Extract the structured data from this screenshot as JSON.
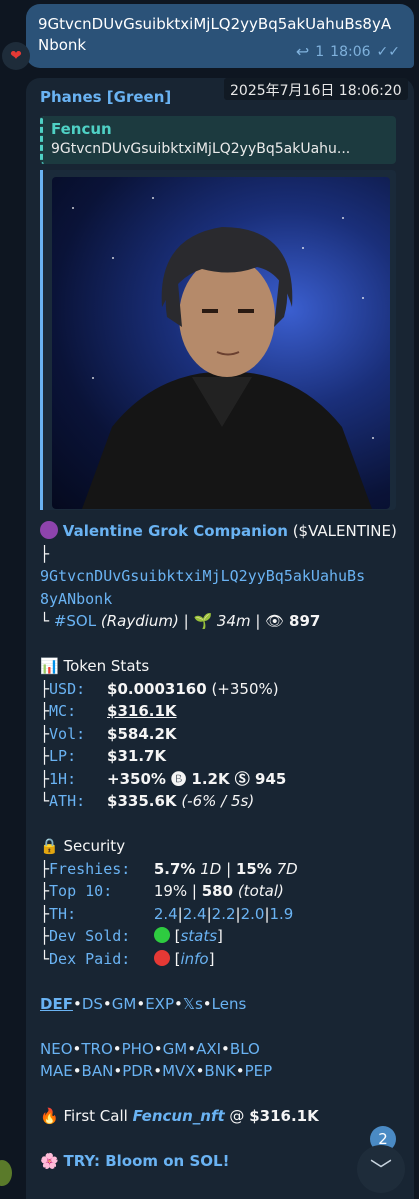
{
  "outgoing": {
    "text": "9GtvcnDUvGsuibktxiMjLQ2yyBq5akUahuBs8yANbonk",
    "reply_count": "1",
    "time": "18:06",
    "reaction": "❤"
  },
  "incoming": {
    "sender": "Phanes [Green]",
    "timestamp_tooltip": "2025年7月16日 18:06:20",
    "quote": {
      "title": "Fencun",
      "text": "9GtvcnDUvGsuibktxiMjLQ2yyBq5akUahu..."
    },
    "token": {
      "name": "Valentine Grok Companion",
      "ticker": "($VALENTINE)",
      "branch": "├",
      "address_1": "9GtvcnDUvGsuibktxiMjLQ2yyBq5akUahuBs",
      "address_2": "8yANbonk",
      "chain_prefix": "└",
      "chain": "#SOL",
      "dex": "(Raydium)",
      "sep1": " | 🌱 ",
      "age": "34m",
      "sep2": " | 👁 ",
      "views": "897"
    },
    "stats": {
      "title": "Token Stats",
      "rows": [
        {
          "prefix": "├",
          "label": "USD:",
          "value": "$0.0003160",
          "extra": " (+350%)"
        },
        {
          "prefix": "├",
          "label": "MC:",
          "value": "$316.1K",
          "extra": ""
        },
        {
          "prefix": "├",
          "label": "Vol:",
          "value": "$584.2K",
          "extra": ""
        },
        {
          "prefix": "├",
          "label": "LP:",
          "value": "$31.7K",
          "extra": ""
        },
        {
          "prefix": "├",
          "label": "1H:",
          "value": "+350% 🅑 1.2K Ⓢ 945",
          "extra": ""
        },
        {
          "prefix": "└",
          "label": "ATH:",
          "value": "$335.6K",
          "extra": " (-6% / 5s)"
        }
      ]
    },
    "security": {
      "title": "Security",
      "freshies_label": "Freshies:",
      "freshies_a": "5.7%",
      "freshies_a_unit": " 1D",
      "freshies_sep": " | ",
      "freshies_b": "15%",
      "freshies_b_unit": " 7D",
      "top10_label": "Top 10:",
      "top10_a": "19%",
      "top10_sep": " | ",
      "top10_b": "580",
      "top10_b_unit": " (total)",
      "th_label": "TH:",
      "th_values": [
        "2.4",
        "2.4",
        "2.2",
        "2.0",
        "1.9"
      ],
      "dev_sold_label": "Dev Sold:",
      "dev_sold_link": "stats",
      "dex_paid_label": "Dex Paid:",
      "dex_paid_link": "info"
    },
    "links_row": [
      "DEF",
      "DS",
      "GM",
      "EXP",
      "𝕏s",
      "Lens"
    ],
    "bots_row1": [
      "NEO",
      "TRO",
      "PHO",
      "GM",
      "AXI",
      "BLO"
    ],
    "bots_row2": [
      "MAE",
      "BAN",
      "PDR",
      "MVX",
      "BNK",
      "PEP"
    ],
    "first_call": {
      "prefix": "First Call",
      "caller": "Fencun_nft",
      "at": " @ ",
      "value": "$316.1K"
    },
    "try": "TRY: Bloom on SOL!"
  },
  "scroll": {
    "unread": "2"
  },
  "colors": {
    "bg": "#0e1621",
    "out_bubble": "#2b5278",
    "in_bubble": "#182533",
    "link": "#6ab3f3",
    "quote": "#4fd1c5"
  }
}
